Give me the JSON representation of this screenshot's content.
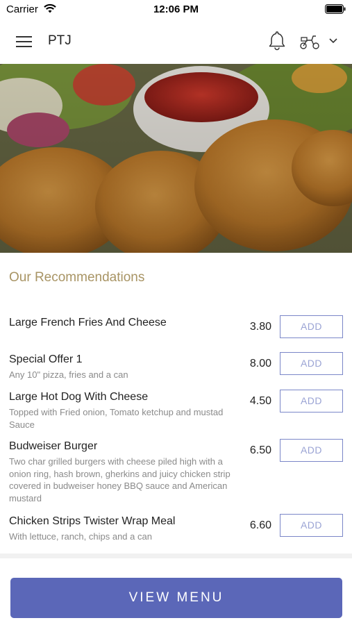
{
  "status_bar": {
    "carrier": "Carrier",
    "time": "12:06 PM"
  },
  "app_bar": {
    "title": "PTJ"
  },
  "section": {
    "title": "Our Recommendations"
  },
  "items": [
    {
      "name": "Large French Fries And Cheese",
      "description": "",
      "price": "3.80",
      "button": "ADD"
    },
    {
      "name": "Special Offer 1",
      "description": "Any 10\" pizza, fries and a can",
      "price": "8.00",
      "button": "ADD"
    },
    {
      "name": "Large Hot Dog With Cheese",
      "description": "Topped with Fried onion, Tomato ketchup and mustad Sauce",
      "price": "4.50",
      "button": "ADD"
    },
    {
      "name": "Budweiser Burger",
      "description": "Two char grilled burgers with cheese piled high with a onion ring, hash brown, gherkins and juicy chicken strip covered in budweiser honey BBQ sauce and American mustard",
      "price": "6.50",
      "button": "ADD"
    },
    {
      "name": "Chicken Strips Twister Wrap Meal",
      "description": "With lettuce, ranch, chips and a can",
      "price": "6.60",
      "button": "ADD"
    }
  ],
  "footer": {
    "view_menu_label": "VIEW MENU"
  },
  "colors": {
    "accent": "#5b67b8",
    "section_title": "#a89464",
    "add_border": "#7a86c8"
  }
}
